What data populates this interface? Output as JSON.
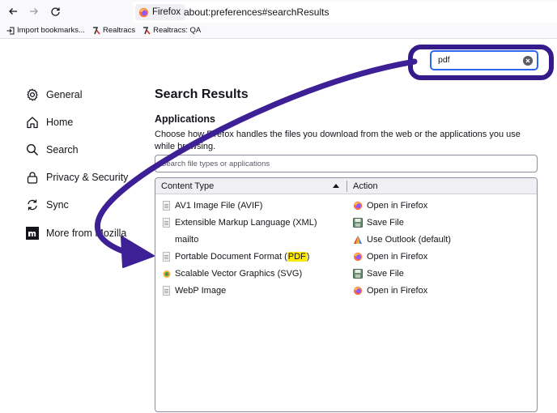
{
  "browser": {
    "identity_label": "Firefox",
    "url": "about:preferences#searchResults"
  },
  "bookmarks": [
    {
      "label": "Import bookmarks..."
    },
    {
      "label": "Realtracs"
    },
    {
      "label": "Realtracs: QA"
    }
  ],
  "search": {
    "value": "pdf"
  },
  "sidebar": {
    "items": [
      {
        "label": "General",
        "icon": "gear-icon"
      },
      {
        "label": "Home",
        "icon": "home-icon"
      },
      {
        "label": "Search",
        "icon": "search-icon"
      },
      {
        "label": "Privacy & Security",
        "icon": "lock-icon"
      },
      {
        "label": "Sync",
        "icon": "sync-icon"
      },
      {
        "label": "More from Mozilla",
        "icon": "mozilla-icon"
      }
    ]
  },
  "main": {
    "title": "Search Results",
    "section_title": "Applications",
    "description": "Choose how Firefox handles the files you download from the web or the applications you use while browsing.",
    "filter_placeholder": "Search file types or applications",
    "table": {
      "col_content_type": "Content Type",
      "col_action": "Action",
      "rows": [
        {
          "type_pre": "AV1 Image File (AVIF)",
          "type_hl": "",
          "type_post": "",
          "action": "Open in Firefox",
          "action_icon": "firefox-icon"
        },
        {
          "type_pre": "Extensible Markup Language (XML)",
          "type_hl": "",
          "type_post": "",
          "action": "Save File",
          "action_icon": "save-icon"
        },
        {
          "type_pre": "mailto",
          "type_hl": "",
          "type_post": "",
          "action": "Use Outlook (default)",
          "action_icon": "outlook-icon"
        },
        {
          "type_pre": "Portable Document Format (",
          "type_hl": "PDF",
          "type_post": ")",
          "action": "Open in Firefox",
          "action_icon": "firefox-icon"
        },
        {
          "type_pre": "Scalable Vector Graphics (SVG)",
          "type_hl": "",
          "type_post": "",
          "action": "Save File",
          "action_icon": "save-icon"
        },
        {
          "type_pre": "WebP Image",
          "type_hl": "",
          "type_post": "",
          "action": "Open in Firefox",
          "action_icon": "firefox-icon"
        }
      ]
    }
  },
  "colors": {
    "annotation": "#351a8a",
    "highlight": "#ffe900",
    "focus": "#2c66f0"
  }
}
